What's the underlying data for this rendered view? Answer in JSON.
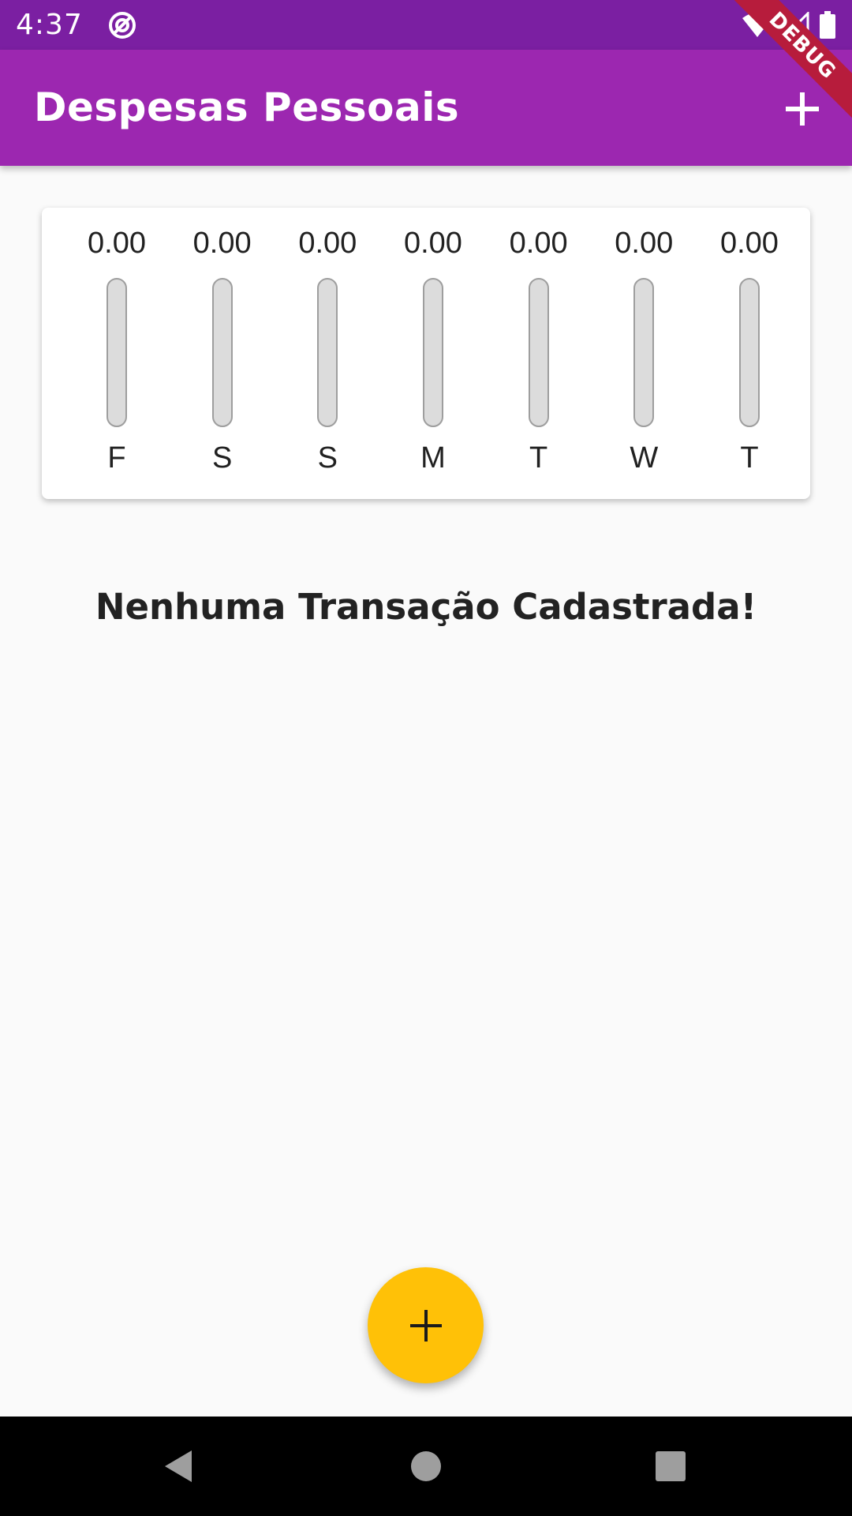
{
  "status_bar": {
    "time": "4:37",
    "icons": [
      "do-not-disturb-icon",
      "wifi-icon",
      "cellular-signal-icon",
      "battery-icon"
    ]
  },
  "app_bar": {
    "title": "Despesas Pessoais",
    "action_icon": "add-icon"
  },
  "debug_banner": "DEBUG",
  "chart_data": {
    "type": "bar",
    "categories": [
      "F",
      "S",
      "S",
      "M",
      "T",
      "W",
      "T"
    ],
    "values": [
      0.0,
      0.0,
      0.0,
      0.0,
      0.0,
      0.0,
      0.0
    ],
    "value_labels": [
      "0.00",
      "0.00",
      "0.00",
      "0.00",
      "0.00",
      "0.00",
      "0.00"
    ],
    "title": "",
    "xlabel": "",
    "ylabel": ""
  },
  "empty_message": "Nenhuma Transação Cadastrada!",
  "fab": {
    "icon": "add-icon"
  },
  "nav_bar": {
    "icons": [
      "back-icon",
      "home-icon",
      "recents-icon"
    ]
  },
  "colors": {
    "status_bar": "#7b1fa2",
    "app_bar": "#9c27b0",
    "fab": "#ffc107",
    "bar_track": "#dcdcdc",
    "background": "#fafafa"
  }
}
